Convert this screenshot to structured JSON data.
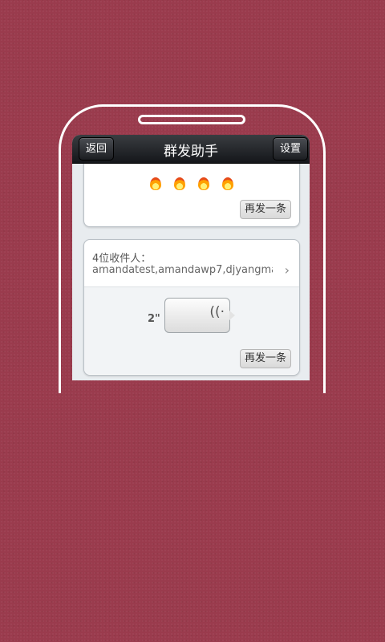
{
  "header": {
    "title": "群发助手",
    "back_label": "返回",
    "settings_label": "设置"
  },
  "messages": [
    {
      "content": "fire emojis",
      "resend_label": "再发一条"
    },
    {
      "recipients_count": "4位收件人：",
      "recipients": "amandatest,amandawp7,djyangmao...",
      "voice_duration": "2\"",
      "resend_label": "再发一条"
    }
  ],
  "icons": {
    "emoji": "fire-emoji",
    "chevron": "chevron-right-icon",
    "voice": "sound-wave-icon"
  },
  "colors": {
    "background": "#9a3b4d",
    "titlebar": "#1e2024",
    "card": "#ffffff"
  }
}
